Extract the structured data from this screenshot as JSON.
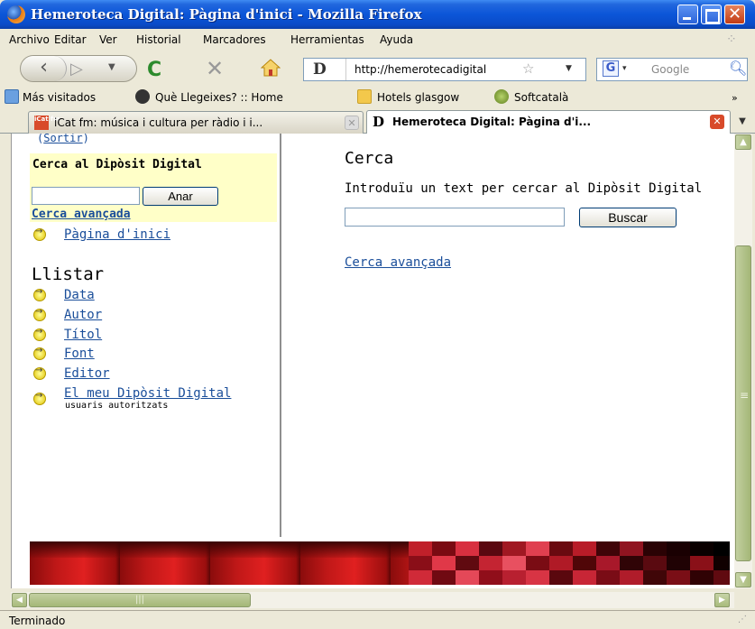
{
  "window": {
    "title": "Hemeroteca Digital: Pàgina d'inici - Mozilla Firefox"
  },
  "menu": [
    "Archivo",
    "Editar",
    "Ver",
    "Historial",
    "Marcadores",
    "Herramientas",
    "Ayuda"
  ],
  "navbar": {
    "url": "http://hemerotecadigital",
    "search_placeholder": "Google"
  },
  "bookmarks": [
    "Más visitados",
    "Què Llegeixes? :: Home",
    "Hotels glasgow",
    "Softcatalà"
  ],
  "tabs": [
    {
      "label": "iCat fm: música i cultura per ràdio i i...",
      "active": false
    },
    {
      "label": "Hemeroteca Digital: Pàgina d'i...",
      "active": true
    }
  ],
  "sidebar": {
    "sortir": "Sortir",
    "search_heading": "Cerca al Dipòsit Digital",
    "go_button": "Anar",
    "advanced_link": "Cerca avançada",
    "home_link": "Pàgina d'inici",
    "list_heading": "Llistar",
    "list_items": [
      "Data",
      "Autor",
      "Títol",
      "Font",
      "Editor",
      "El meu Dipòsit Digital"
    ],
    "my_repository_note": "usuaris autoritzats"
  },
  "main": {
    "title": "Cerca",
    "intro": "Introduïu un text per cercar al Dipòsit Digital",
    "search_button": "Buscar",
    "advanced_link": "Cerca avançada"
  },
  "status": {
    "text": "Terminado"
  },
  "colors": {
    "link": "#1a4e9a",
    "search_panel_bg": "#ffffc8",
    "titlebar": "#0b55d8",
    "footer_red": "#c01818"
  },
  "icons": [
    "firefox-icon",
    "back-icon",
    "forward-icon",
    "reload-icon",
    "stop-icon",
    "home-icon",
    "bookmark-star-icon",
    "google-icon",
    "search-icon",
    "folder-icon",
    "arrow-bullet-icon"
  ]
}
